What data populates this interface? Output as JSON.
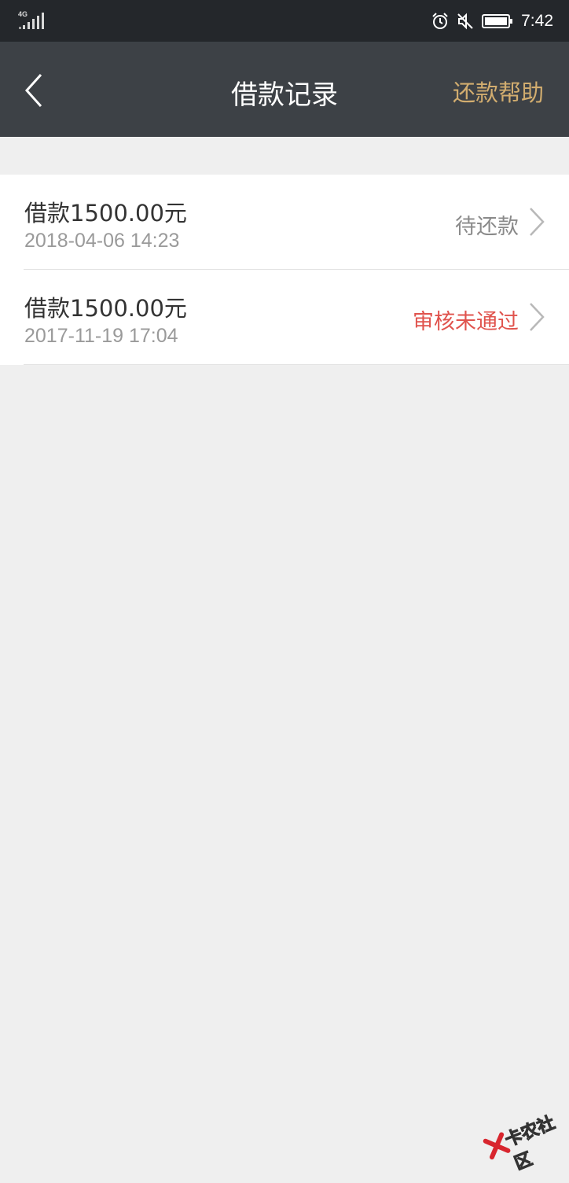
{
  "status_bar": {
    "network": "4G",
    "time": "7:42",
    "icons": [
      "signal-icon",
      "alarm-icon",
      "mute-icon",
      "battery-icon"
    ]
  },
  "nav": {
    "back_icon": "chevron-left-icon",
    "title": "借款记录",
    "help_label": "还款帮助"
  },
  "records": [
    {
      "title": "借款1500.00元",
      "date": "2018-04-06 14:23",
      "status": "待还款",
      "status_color": "#8a8a8a"
    },
    {
      "title": "借款1500.00元",
      "date": "2017-11-19 17:04",
      "status": "审核未通过",
      "status_color": "#e0534d"
    }
  ],
  "watermark": {
    "text": "卡农社区"
  },
  "colors": {
    "status_bar_bg": "#24272b",
    "nav_bg": "#3d4146",
    "accent_gold": "#d2ad6f",
    "page_bg": "#efefef",
    "error_red": "#e0534d"
  }
}
